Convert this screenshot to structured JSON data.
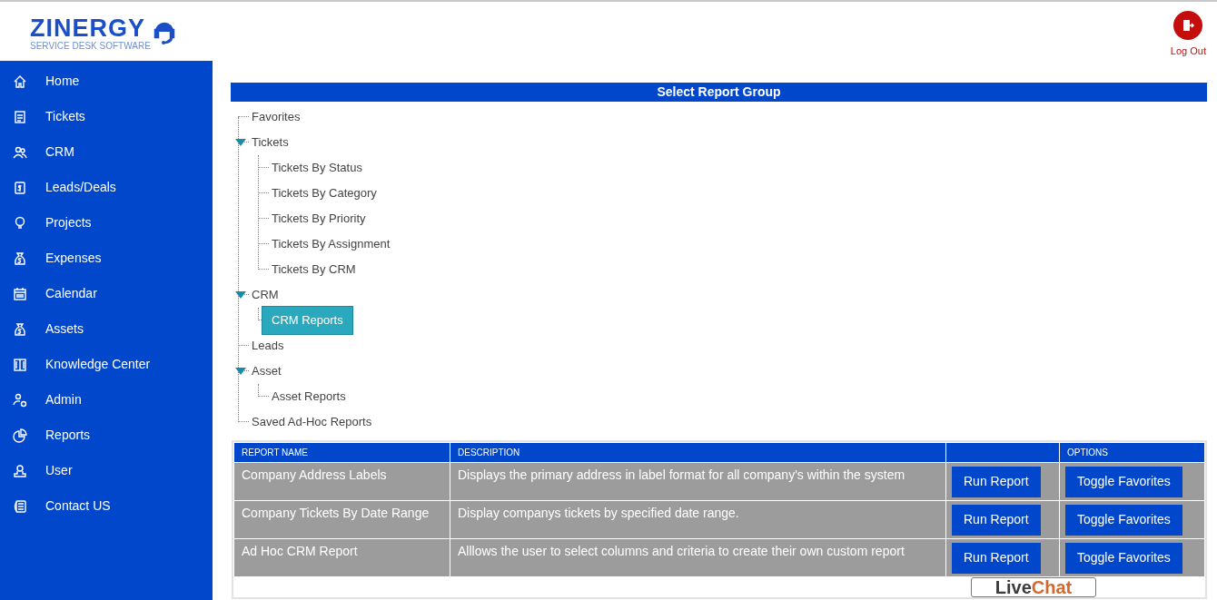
{
  "logo": {
    "name": "ZINERGY",
    "tagline": "SERVICE DESK SOFTWARE"
  },
  "logout": {
    "label": "Log Out"
  },
  "sidebar": {
    "items": [
      {
        "label": "Home",
        "selected": false
      },
      {
        "label": "Tickets",
        "selected": false
      },
      {
        "label": "CRM",
        "selected": false
      },
      {
        "label": "Leads/Deals",
        "selected": false
      },
      {
        "label": "Projects",
        "selected": false
      },
      {
        "label": "Expenses",
        "selected": false
      },
      {
        "label": "Calendar",
        "selected": false
      },
      {
        "label": "Assets",
        "selected": false
      },
      {
        "label": "Knowledge Center",
        "selected": false
      },
      {
        "label": "Admin",
        "selected": false
      },
      {
        "label": "Reports",
        "selected": false
      },
      {
        "label": "User",
        "selected": false
      },
      {
        "label": "Contact US",
        "selected": false
      }
    ]
  },
  "report_group": {
    "title": "Select Report Group",
    "tree": [
      {
        "label": "Favorites",
        "selected": false
      },
      {
        "label": "Tickets",
        "expanded": true,
        "selected": false,
        "children": [
          {
            "label": "Tickets By Status",
            "selected": false
          },
          {
            "label": "Tickets By Category",
            "selected": false
          },
          {
            "label": "Tickets By Priority",
            "selected": false
          },
          {
            "label": "Tickets By Assignment",
            "selected": false
          },
          {
            "label": "Tickets By CRM",
            "selected": false
          }
        ]
      },
      {
        "label": "CRM",
        "expanded": true,
        "selected": false,
        "children": [
          {
            "label": "CRM Reports",
            "selected": true
          }
        ]
      },
      {
        "label": "Leads",
        "selected": false
      },
      {
        "label": "Asset",
        "expanded": true,
        "selected": false,
        "children": [
          {
            "label": "Asset Reports",
            "selected": false
          }
        ]
      },
      {
        "label": "Saved Ad-Hoc Reports",
        "selected": false
      }
    ]
  },
  "table": {
    "columns": [
      "REPORT NAME",
      "DESCRIPTION",
      "",
      "OPTIONS"
    ],
    "rows": [
      {
        "name": "Company Address Labels",
        "description": "Displays the primary address in label format for all company's within the system",
        "run": "Run Report",
        "toggle": "Toggle Favorites"
      },
      {
        "name": "Company Tickets By Date Range",
        "description": "Display companys tickets by specified date range.",
        "run": "Run Report",
        "toggle": "Toggle Favorites"
      },
      {
        "name": "Ad Hoc CRM Report",
        "description": "Alllows the user to select columns and criteria to create their own custom report",
        "run": "Run Report",
        "toggle": "Toggle Favorites"
      }
    ]
  },
  "live_chat": {
    "live": "Live",
    "chat": "Chat"
  }
}
